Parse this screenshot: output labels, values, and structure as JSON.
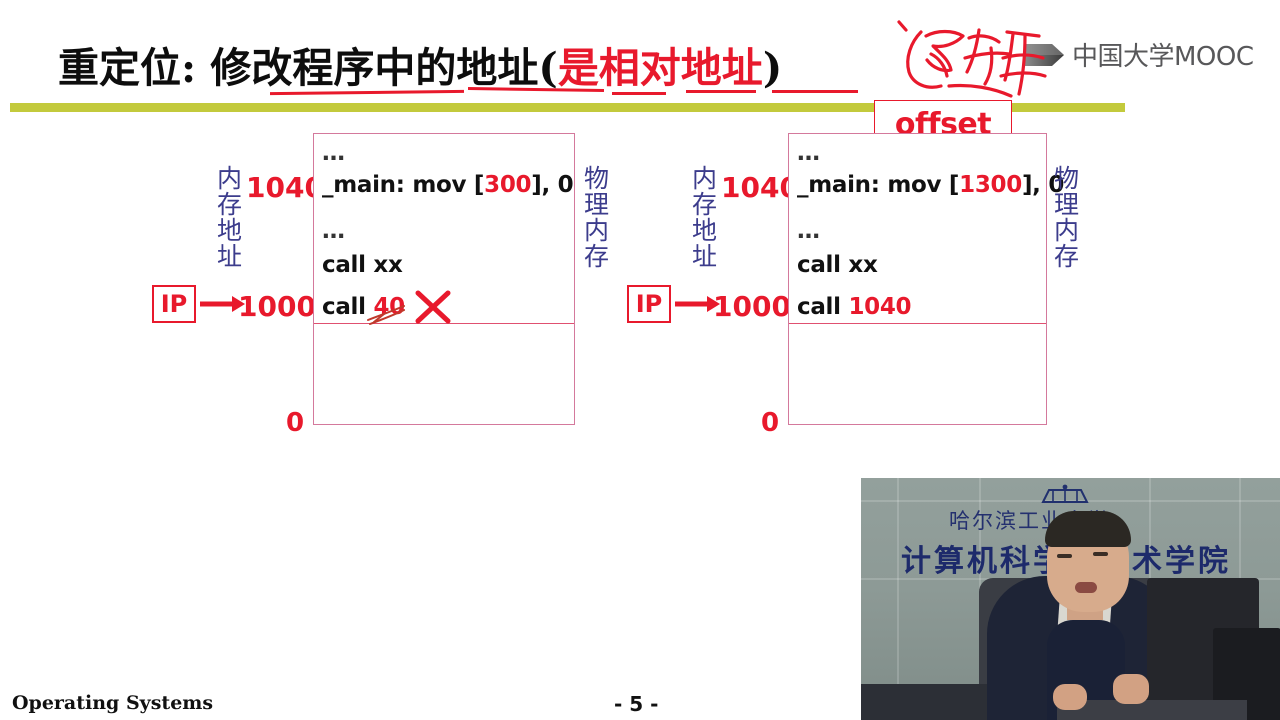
{
  "slide": {
    "title_black_prefix": "重定位: 修改程序中的地址(",
    "title_red": "是相对地址",
    "title_black_suffix": ")",
    "handwriting_annotation": "逻辑"
  },
  "logo": {
    "icon": "play-triangle-icon",
    "text": "中国大学MOOC"
  },
  "callout": {
    "offset_label": "offset"
  },
  "left_diagram": {
    "memory_axis_label": "内存地址",
    "physical_memory_label": "物理内存",
    "addr_top": "1040",
    "addr_ip": "1000",
    "addr_bottom": "0",
    "register_label": "IP",
    "arrow_icon": "right-arrow-icon",
    "error_mark_icon": "red-x-icon",
    "code": [
      {
        "text": "…",
        "kind": "dots"
      },
      {
        "prefix": "_main: mov [",
        "red": "300",
        "suffix": "],  0",
        "kind": "code"
      },
      {
        "text": "…",
        "kind": "dots"
      },
      {
        "prefix": "call xx",
        "red": "",
        "suffix": "",
        "kind": "code"
      },
      {
        "prefix": "call ",
        "red": "40",
        "suffix": "",
        "kind": "code"
      }
    ]
  },
  "right_diagram": {
    "memory_axis_label": "内存地址",
    "physical_memory_label": "物理内存",
    "addr_top": "1040",
    "addr_ip": "1000",
    "addr_bottom": "0",
    "register_label": "IP",
    "arrow_icon": "right-arrow-icon",
    "code": [
      {
        "text": "…",
        "kind": "dots"
      },
      {
        "prefix": "_main: mov [",
        "red": "1300",
        "suffix": "],  0",
        "kind": "code"
      },
      {
        "text": "…",
        "kind": "dots"
      },
      {
        "prefix": "call xx",
        "red": "",
        "suffix": "",
        "kind": "code"
      },
      {
        "prefix": "call ",
        "red": "1040",
        "suffix": "",
        "kind": "code"
      }
    ]
  },
  "footer": {
    "course": "Operating Systems",
    "page": "- 5 -"
  },
  "video": {
    "wall_line1": "哈尔滨工业大学",
    "wall_line2": "计算机科学与技术学院"
  },
  "colors": {
    "red": "#e8192c",
    "olive_bar": "#c3ca3c",
    "navy_label": "#3c3c8c",
    "box_border": "#d4799c",
    "logo_gray": "#58585a"
  }
}
